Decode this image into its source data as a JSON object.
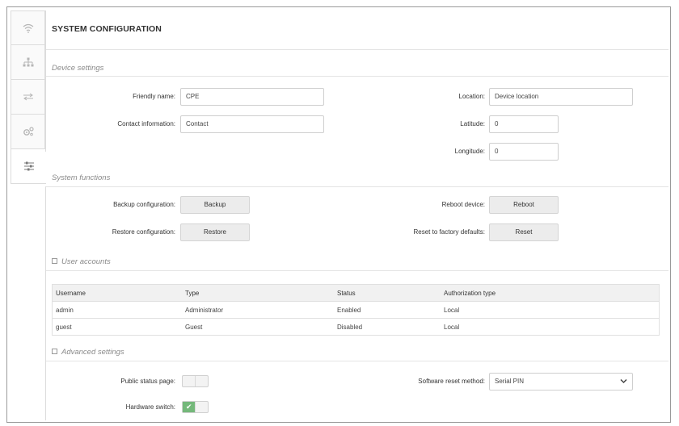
{
  "sidebar": {
    "items": [
      {
        "icon": "wifi-icon"
      },
      {
        "icon": "network-tree-icon"
      },
      {
        "icon": "arrows-exchange-icon"
      },
      {
        "icon": "gears-icon"
      },
      {
        "icon": "sliders-icon",
        "active": true
      }
    ]
  },
  "page": {
    "title": "SYSTEM CONFIGURATION"
  },
  "device_settings": {
    "title": "Device settings",
    "friendly_name_label": "Friendly name:",
    "friendly_name_value": "CPE",
    "contact_label": "Contact information:",
    "contact_value": "Contact",
    "location_label": "Location:",
    "location_value": "Device location",
    "latitude_label": "Latitude:",
    "latitude_value": "0",
    "longitude_label": "Longitude:",
    "longitude_value": "0"
  },
  "system_functions": {
    "title": "System functions",
    "backup_label": "Backup configuration:",
    "backup_button": "Backup",
    "restore_label": "Restore configuration:",
    "restore_button": "Restore",
    "reboot_label": "Reboot device:",
    "reboot_button": "Reboot",
    "reset_label": "Reset to factory defaults:",
    "reset_button": "Reset"
  },
  "user_accounts": {
    "title": "User accounts",
    "columns": [
      "Username",
      "Type",
      "Status",
      "Authorization type"
    ],
    "rows": [
      [
        "admin",
        "Administrator",
        "Enabled",
        "Local"
      ],
      [
        "guest",
        "Guest",
        "Disabled",
        "Local"
      ]
    ]
  },
  "advanced_settings": {
    "title": "Advanced settings",
    "public_status_label": "Public status page:",
    "public_status_on": false,
    "hardware_switch_label": "Hardware switch:",
    "hardware_switch_on": true,
    "reset_method_label": "Software reset method:",
    "reset_method_value": "Serial PIN"
  },
  "colors": {
    "toggle_on": "#74b87a",
    "button_bg": "#ececec"
  }
}
